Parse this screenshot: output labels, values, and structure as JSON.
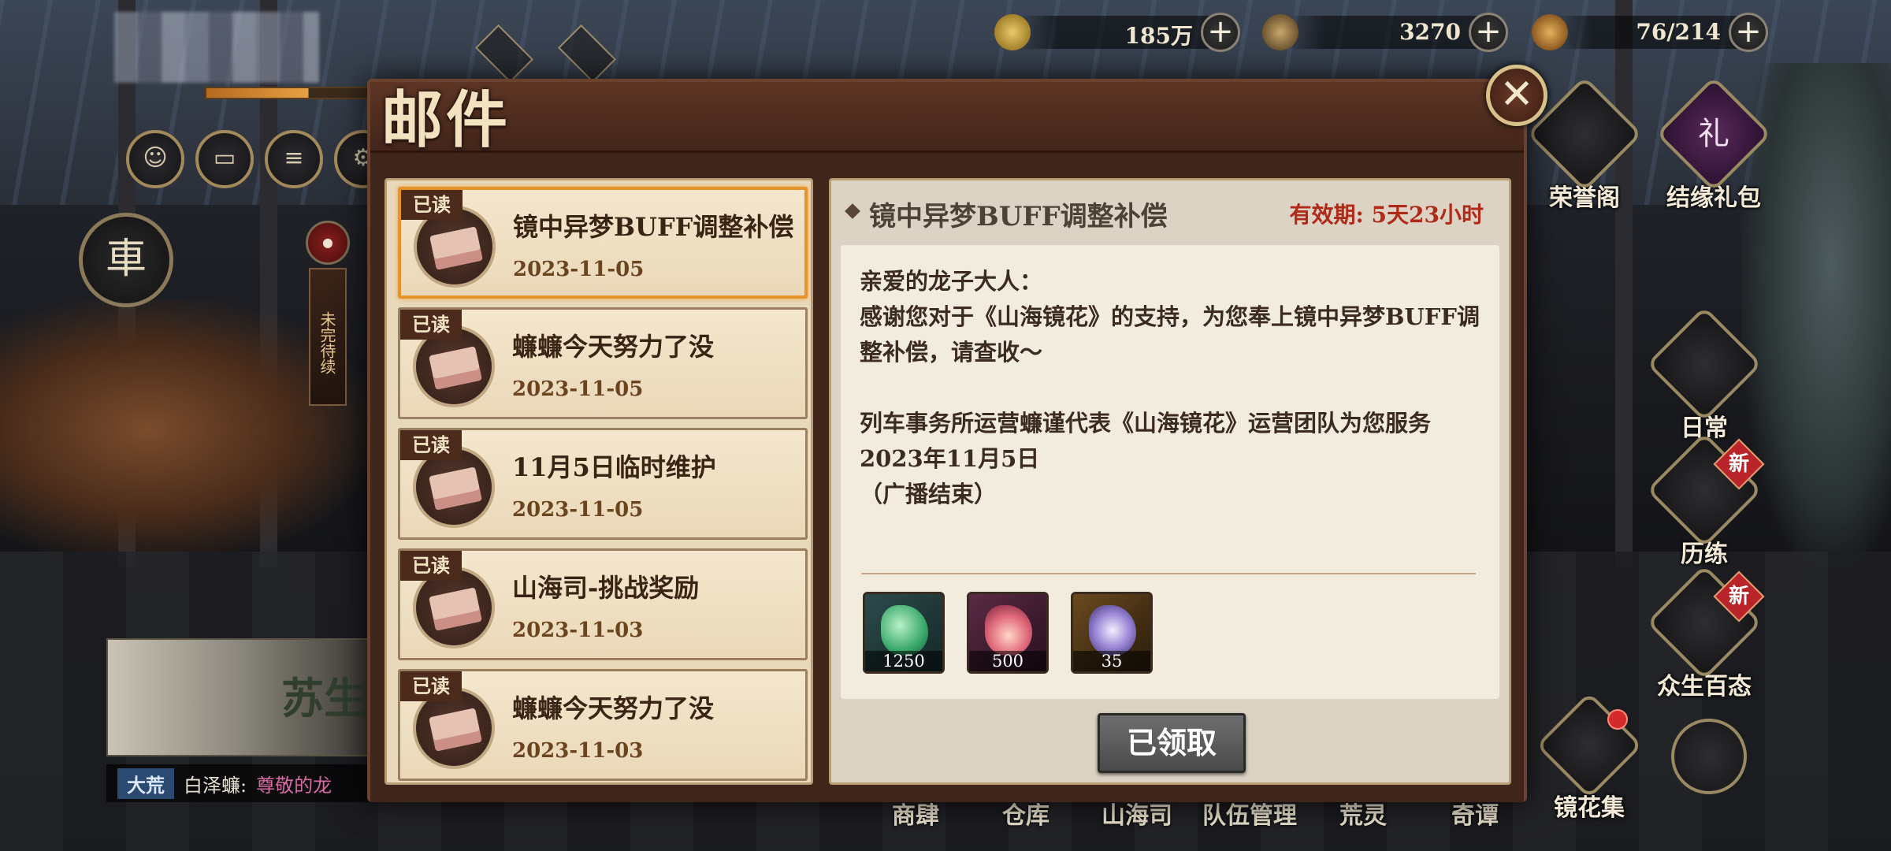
{
  "resources": [
    {
      "icon": "coin-icon",
      "value": "185万"
    },
    {
      "icon": "gear-token-icon",
      "value": "3270"
    },
    {
      "icon": "stamina-key-icon",
      "value": "76/214"
    }
  ],
  "plus_label": "+",
  "left_hud": {
    "char_badge": "車",
    "vertical_banner": "未完待续",
    "banner_title": "苏生",
    "chat": {
      "channel": "大荒",
      "sender": "白泽蠊:",
      "message": "尊敬的龙"
    }
  },
  "right_hud": {
    "honor_hall": "荣誉阁",
    "bond_pack": "结缘礼包",
    "bond_pack_glyph": "礼",
    "daily": "日常",
    "trials": "历练",
    "all_beings": "众生百态",
    "mirror_collection": "镜花集",
    "new_badge": "新"
  },
  "bottom_nav": [
    "商肆",
    "仓库",
    "山海司",
    "队伍管理",
    "荒灵",
    "奇谭"
  ],
  "dialog": {
    "title": "邮件",
    "close_symbol": "✕"
  },
  "mail_list": [
    {
      "read_tag": "已读",
      "subject": "镜中异梦BUFF调整补偿",
      "date": "2023-11-05",
      "selected": true
    },
    {
      "read_tag": "已读",
      "subject": "蠊蠊今天努力了没",
      "date": "2023-11-05"
    },
    {
      "read_tag": "已读",
      "subject": "11月5日临时维护",
      "date": "2023-11-05"
    },
    {
      "read_tag": "已读",
      "subject": "山海司-挑战奖励",
      "date": "2023-11-03"
    },
    {
      "read_tag": "已读",
      "subject": "蠊蠊今天努力了没",
      "date": "2023-11-03"
    }
  ],
  "detail": {
    "title": "镜中异梦BUFF调整补偿",
    "validity": "有效期: 5天23小时",
    "body_lines": [
      "亲爱的龙子大人：",
      "感谢您对于《山海镜花》的支持，为您奉上镜中异梦BUFF调",
      "整补偿，请查收～",
      "",
      "列车事务所运营蠊谨代表《山海镜花》运营团队为您服务",
      "2023年11月5日",
      "（广播结束）"
    ],
    "rewards": [
      {
        "icon": "green-crystal-icon",
        "qty": "1250"
      },
      {
        "icon": "pink-flower-icon",
        "qty": "500"
      },
      {
        "icon": "spirit-lantern-icon",
        "qty": "35"
      }
    ],
    "claim_button": "已领取"
  }
}
